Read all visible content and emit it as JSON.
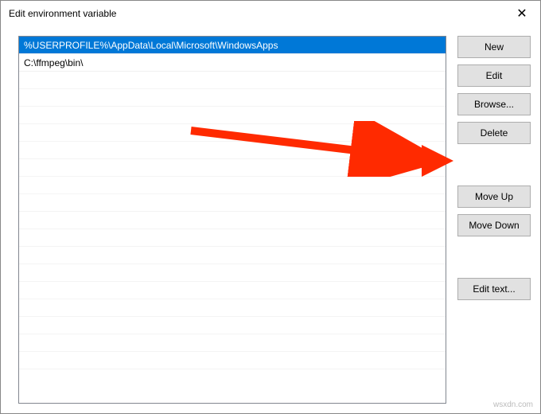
{
  "titlebar": {
    "title": "Edit environment variable",
    "close_glyph": "✕"
  },
  "list": {
    "items": [
      {
        "text": "%USERPROFILE%\\AppData\\Local\\Microsoft\\WindowsApps",
        "selected": true
      },
      {
        "text": "C:\\ffmpeg\\bin\\",
        "selected": false
      }
    ]
  },
  "buttons": {
    "new": "New",
    "edit": "Edit",
    "browse": "Browse...",
    "delete": "Delete",
    "move_up": "Move Up",
    "move_down": "Move Down",
    "edit_text": "Edit text..."
  },
  "annotation": {
    "color": "#ff2a00"
  },
  "watermark": "wsxdn.com"
}
